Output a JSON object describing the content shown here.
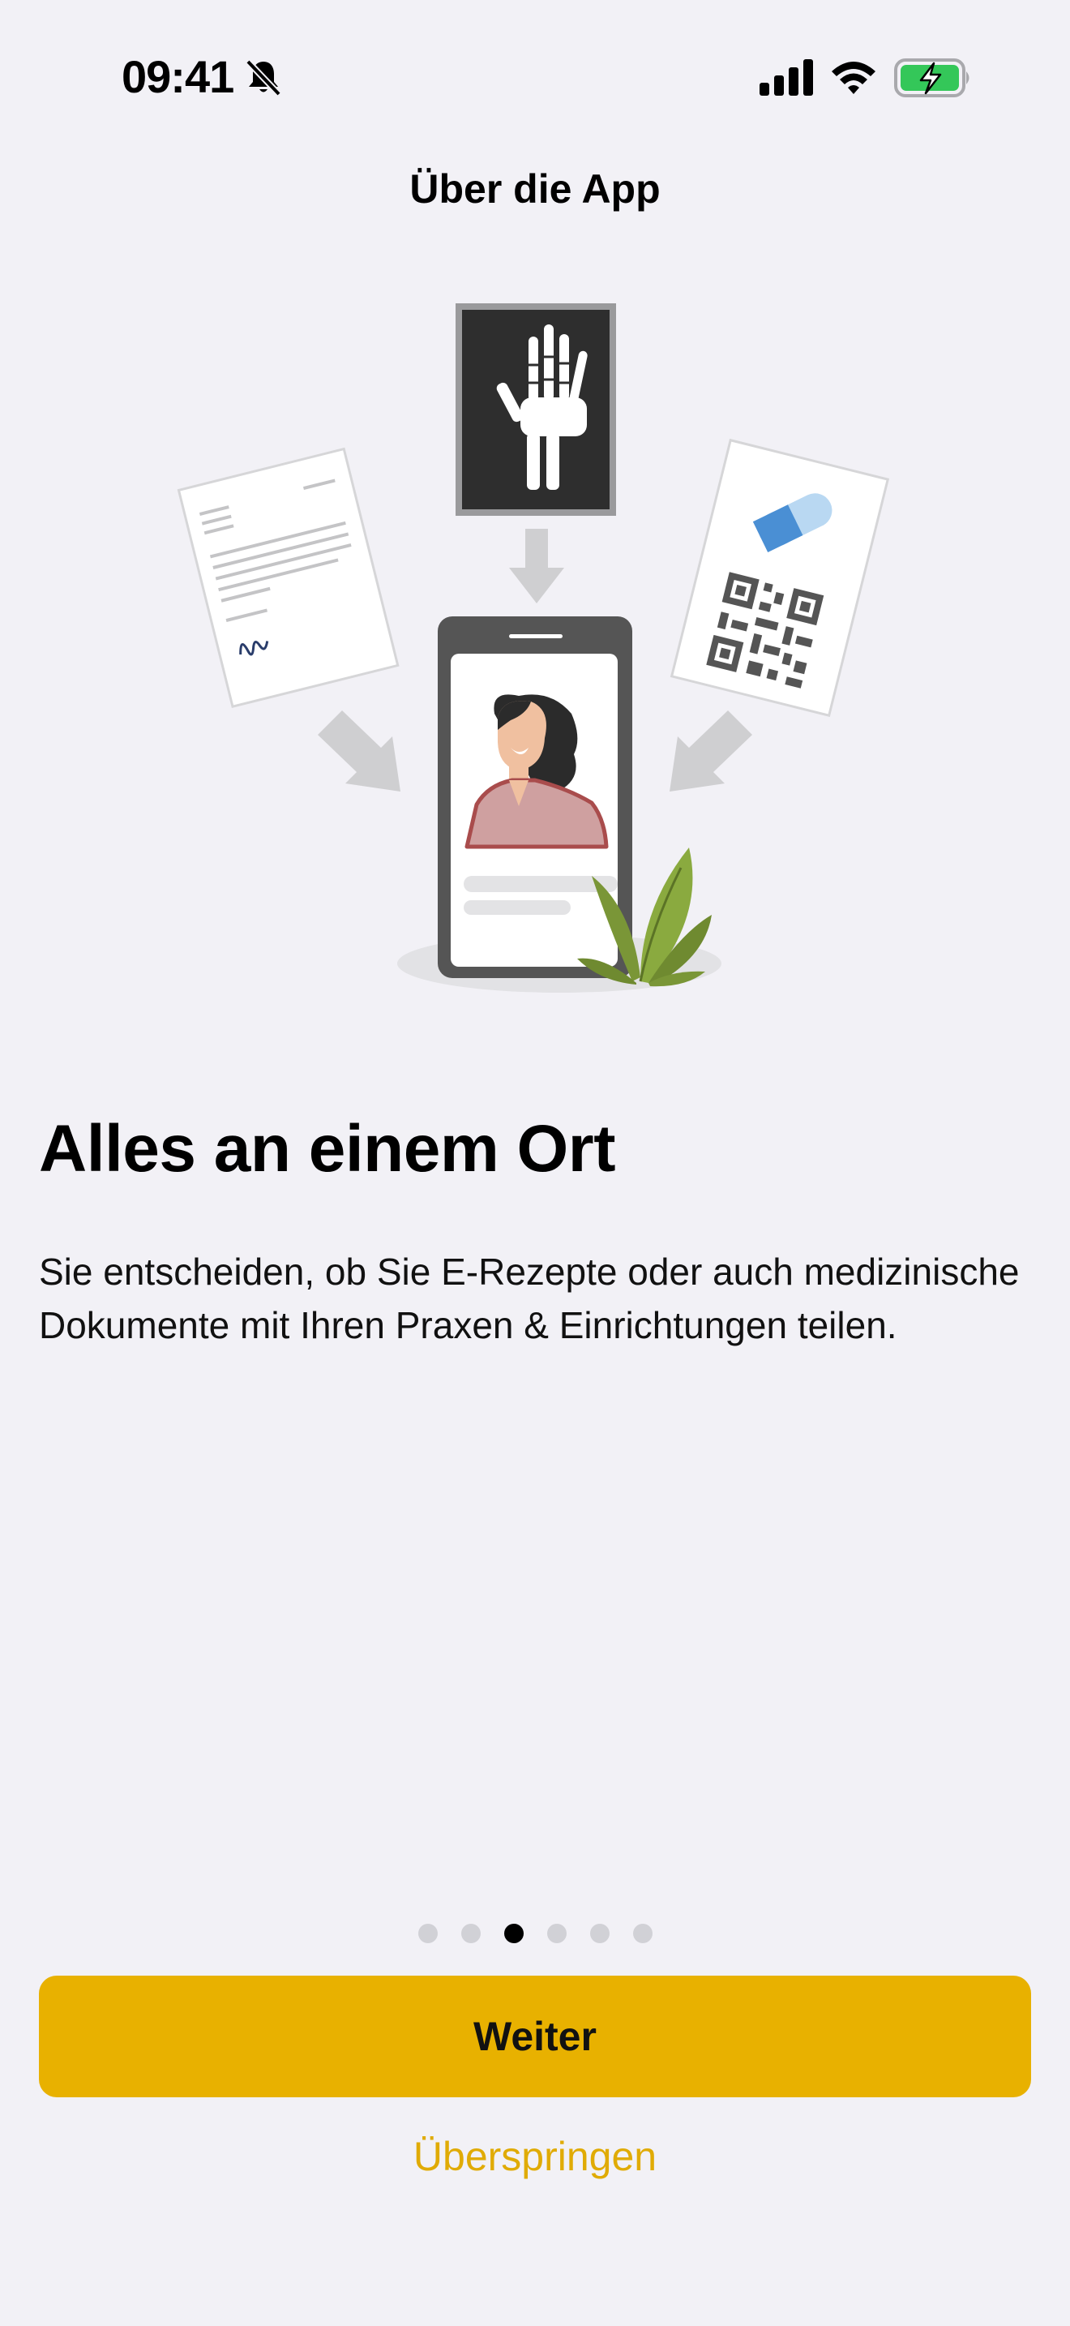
{
  "status_bar": {
    "time": "09:41",
    "icons": [
      "bell-slash-icon",
      "cellular-signal-icon",
      "wifi-icon",
      "battery-charging-icon"
    ],
    "battery_color": "#34c759"
  },
  "nav": {
    "title": "Über die App"
  },
  "onboarding": {
    "headline": "Alles an einem Ort",
    "description": "Sie entscheiden, ob Sie E-Rezepte oder auch medizinische Dokumente mit Ihren Praxen & Einrichtungen teilen.",
    "page_count": 6,
    "current_page": 3
  },
  "actions": {
    "primary_label": "Weiter",
    "skip_label": "Überspringen"
  },
  "colors": {
    "background": "#f2f1f6",
    "accent": "#e8b100",
    "link": "#e0ab05"
  }
}
